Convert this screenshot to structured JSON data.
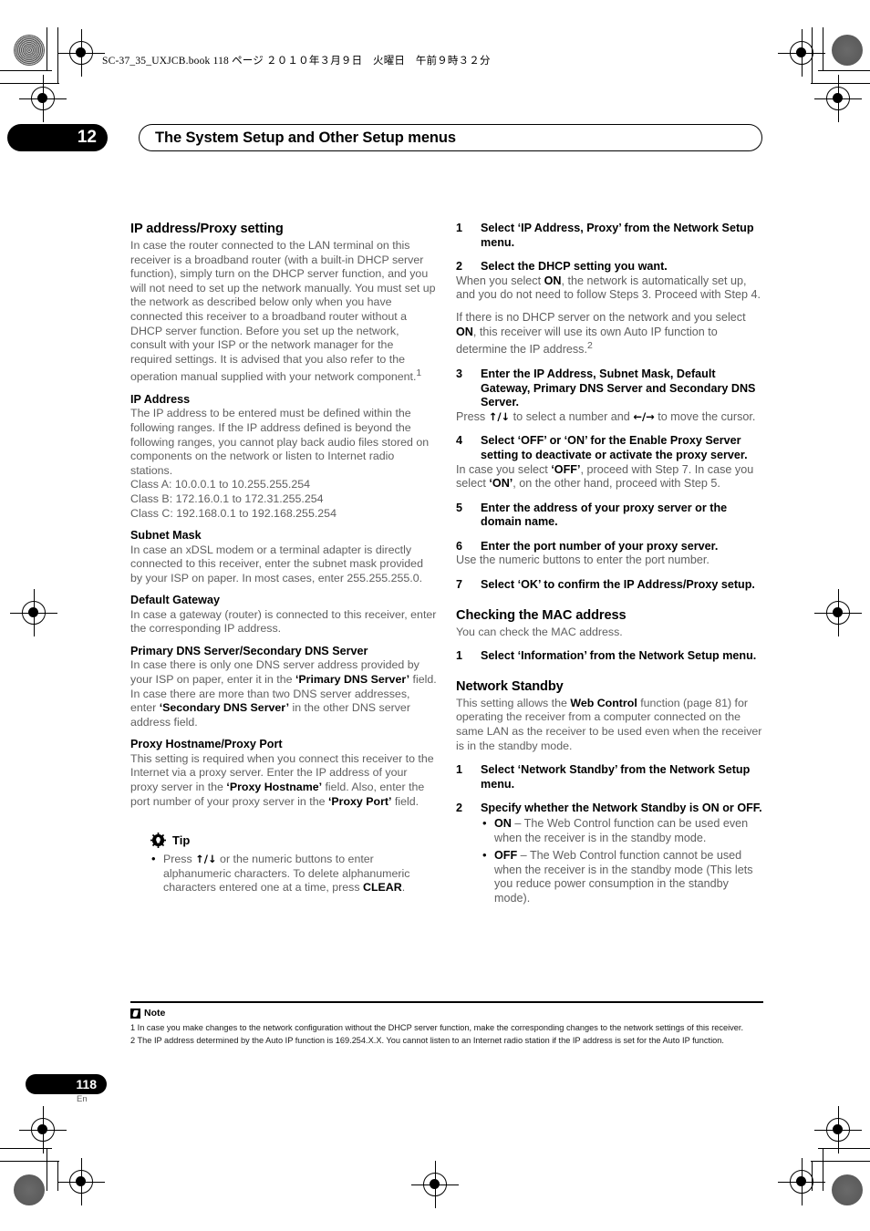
{
  "header": {
    "book_info": "SC-37_35_UXJCB.book   118 ページ   ２０１０年３月９日　火曜日　午前９時３２分"
  },
  "chapter": {
    "number": "12",
    "title": "The System Setup and Other Setup menus"
  },
  "left_column": {
    "section_title": "IP address/Proxy setting",
    "intro": "In case the router connected to the LAN terminal on this receiver is a broadband router (with a built-in DHCP server function), simply turn on the DHCP server function, and you will not need to set up the network manually. You must set up the network as described below only when you have connected this receiver to a broadband router without a DHCP server function. Before you set up the network, consult with your ISP or the network manager for the required settings. It is advised that you also refer to the operation manual supplied with your network component.",
    "intro_footnote": "1",
    "ip_address": {
      "heading": "IP Address",
      "body": "The IP address to be entered must be defined within the following ranges. If the IP address defined is beyond the following ranges, you cannot play back audio files stored on components on the network or listen to Internet radio stations.",
      "class_a": "Class A: 10.0.0.1 to 10.255.255.254",
      "class_b": "Class B: 172.16.0.1 to 172.31.255.254",
      "class_c": "Class C: 192.168.0.1 to 192.168.255.254"
    },
    "subnet_mask": {
      "heading": "Subnet Mask",
      "body": "In case an xDSL modem or a terminal adapter is directly connected to this receiver, enter the subnet mask provided by your ISP on paper. In most cases, enter 255.255.255.0."
    },
    "default_gateway": {
      "heading": "Default Gateway",
      "body": "In case a gateway (router) is connected to this receiver, enter the corresponding IP address."
    },
    "dns_server": {
      "heading": "Primary DNS Server/Secondary DNS Server",
      "body_1": "In case there is only one DNS server address provided by your ISP on paper, enter it in the ",
      "bold_1": "‘Primary DNS Server’",
      "body_2": " field. In case there are more than two DNS server addresses, enter ",
      "bold_2": "‘Secondary DNS Server’",
      "body_3": " in the other DNS server address field."
    },
    "proxy": {
      "heading": "Proxy Hostname/Proxy Port",
      "body_1": "This setting is required when you connect this receiver to the Internet via a proxy server. Enter the IP address of your proxy server in the ",
      "bold_1": "‘Proxy Hostname’",
      "body_2": " field. Also, enter the port number of your proxy server in the ",
      "bold_2": "‘Proxy Port’",
      "body_3": " field."
    },
    "tip": {
      "label": "Tip",
      "text_1": "Press ",
      "arrows": "↑/↓",
      "text_2": " or the numeric buttons to enter alphanumeric characters. To delete alphanumeric characters entered one at a time, press ",
      "bold_clear": "CLEAR",
      "text_3": "."
    }
  },
  "right_column": {
    "steps_proxy": [
      {
        "num": "1",
        "title": "Select ‘IP Address, Proxy’ from the Network Setup menu.",
        "body": ""
      },
      {
        "num": "2",
        "title": "Select the DHCP setting you want.",
        "body_pre": "When you select ",
        "body_bold": "ON",
        "body_post": ", the network is automatically set up, and you do not need to follow Steps 3. Proceed with Step 4.",
        "body2_pre": "If there is no DHCP server on the network and you select ",
        "body2_bold": "ON",
        "body2_post": ", this receiver will use its own Auto IP function to determine the IP address.",
        "body2_footnote": "2"
      },
      {
        "num": "3",
        "title": "Enter the IP Address, Subnet Mask, Default Gateway, Primary DNS Server and Secondary DNS Server.",
        "body_pre": "Press ",
        "arrows_1": "↑/↓",
        "body_mid": " to select a number and ",
        "arrows_2": "←/→",
        "body_post": " to move the cursor."
      },
      {
        "num": "4",
        "title": "Select ‘OFF’ or ‘ON’ for the Enable Proxy Server setting to deactivate or activate the proxy server.",
        "body_pre": "In case you select ",
        "body_bold_1": "‘OFF’",
        "body_mid": ", proceed with Step 7. In case you select ",
        "body_bold_2": "‘ON’",
        "body_post": ", on the other hand, proceed with Step 5."
      },
      {
        "num": "5",
        "title": "Enter the address of your proxy server or the domain name.",
        "body": ""
      },
      {
        "num": "6",
        "title": "Enter the port number of your proxy server.",
        "body": "Use the numeric buttons to enter the port number."
      },
      {
        "num": "7",
        "title": "Select ‘OK’ to confirm the IP Address/Proxy setup.",
        "body": ""
      }
    ],
    "mac_section": {
      "heading": "Checking the MAC address",
      "body": "You can check the MAC address.",
      "step_num": "1",
      "step_title": "Select ‘Information’ from the Network Setup menu."
    },
    "standby_section": {
      "heading": "Network Standby",
      "body_pre": "This setting allows the ",
      "body_bold": "Web Control",
      "body_post": " function (page 81) for operating the receiver from a computer connected on the same LAN as the receiver to be used even when the receiver is in the standby mode.",
      "step1_num": "1",
      "step1_title": "Select ‘Network Standby’ from the Network Setup menu.",
      "step2_num": "2",
      "step2_title": "Specify whether the Network Standby is ON or OFF.",
      "bullets": [
        {
          "bold": "ON",
          "text": " – The Web Control function can be used even when the receiver is in the standby mode."
        },
        {
          "bold": "OFF",
          "text": " – The Web Control function cannot be used when the receiver is in the standby mode (This lets you reduce power consumption in the standby mode)."
        }
      ]
    }
  },
  "notes": {
    "label": "Note",
    "items": [
      "1 In case you make changes to the network configuration without the DHCP server function, make the corresponding changes to the network settings of this receiver.",
      "2 The IP address determined by the Auto IP function is 169.254.X.X. You cannot listen to an Internet radio station if the IP address is set for the Auto IP function."
    ]
  },
  "footer": {
    "page_number": "118",
    "language": "En"
  }
}
